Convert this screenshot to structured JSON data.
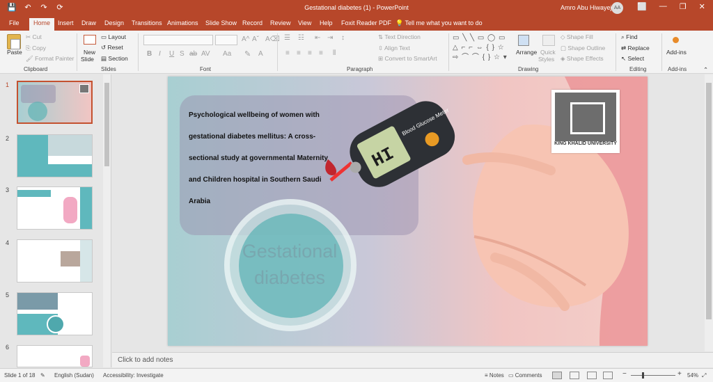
{
  "titlebar": {
    "quick_access": [
      "💾",
      "↶",
      "↷",
      "⟳"
    ],
    "title": "Gestational diabetes (1)  -  PowerPoint",
    "user": "Amro Abu Hiwayej",
    "initials": "AA",
    "win_buttons": [
      "⬜",
      "—",
      "❐",
      "✕"
    ]
  },
  "tabs": [
    "File",
    "Home",
    "Insert",
    "Draw",
    "Design",
    "Transitions",
    "Animations",
    "Slide Show",
    "Record",
    "Review",
    "View",
    "Help",
    "Foxit Reader PDF"
  ],
  "tell_me": "Tell me what you want to do",
  "ribbon": {
    "clipboard": {
      "paste": "Paste",
      "cut": "Cut",
      "copy": "Copy",
      "format_painter": "Format Painter",
      "label": "Clipboard"
    },
    "slides": {
      "new_slide": "New",
      "new_slide2": "Slide",
      "layout": "Layout",
      "reset": "Reset",
      "section": "Section",
      "label": "Slides"
    },
    "font": {
      "label": "Font",
      "buttons": [
        "B",
        "I",
        "U",
        "S",
        "ab",
        "AV",
        "Aa",
        "A"
      ]
    },
    "paragraph": {
      "text_direction": "Text Direction",
      "align_text": "Align Text",
      "convert_smartart": "Convert to SmartArt",
      "label": "Paragraph"
    },
    "drawing": {
      "arrange": "Arrange",
      "quick": "Quick",
      "styles": "Styles",
      "shape_fill": "Shape Fill",
      "shape_outline": "Shape Outline",
      "shape_effects": "Shape Effects",
      "label": "Drawing"
    },
    "editing": {
      "find": "Find",
      "replace": "Replace",
      "select": "Select",
      "label": "Editing"
    },
    "addins": {
      "button": "Add-ins",
      "label": "Add-ins"
    }
  },
  "thumbnails": [
    "1",
    "2",
    "3",
    "4",
    "5",
    "6"
  ],
  "slide": {
    "title_lines": [
      "Psychological wellbeing of women with",
      "gestational diabetes mellitus: A cross-",
      "sectional study at governmental Maternity",
      "and Children hospital in Southern Saudi",
      "Arabia"
    ],
    "circle_line1": "Gestational",
    "circle_line2": "diabetes",
    "meter_label": "Blood Glucose Meter",
    "meter_value": "HI",
    "logo_caption": "KING KHALID UNIVERSITY"
  },
  "notes_placeholder": "Click to add notes",
  "status": {
    "slide": "Slide 1 of 18",
    "language": "English (Sudan)",
    "accessibility": "Accessibility: Investigate",
    "notes": "Notes",
    "comments": "Comments",
    "zoom": "54%"
  }
}
